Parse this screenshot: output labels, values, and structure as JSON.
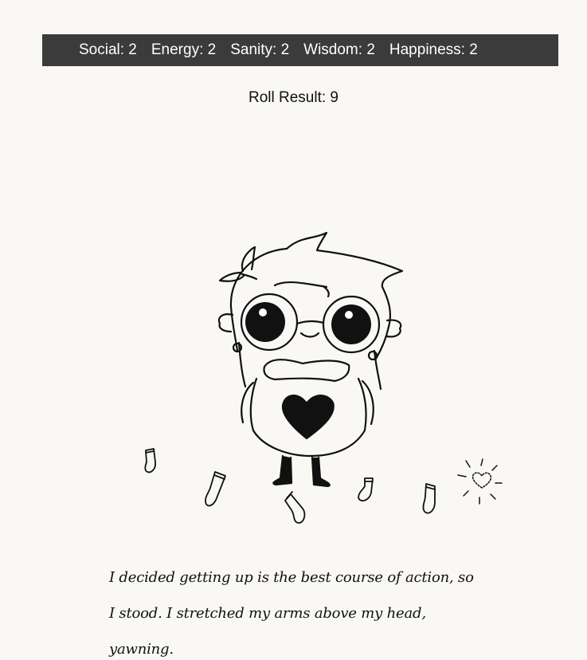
{
  "stats": [
    {
      "label": "Social",
      "value": 2,
      "text": "Social: 2"
    },
    {
      "label": "Energy",
      "value": 2,
      "text": "Energy: 2"
    },
    {
      "label": "Sanity",
      "value": 2,
      "text": "Sanity: 2"
    },
    {
      "label": "Wisdom",
      "value": 2,
      "text": "Wisdom: 2"
    },
    {
      "label": "Happiness",
      "value": 2,
      "text": "Happiness: 2"
    }
  ],
  "roll": {
    "text": "Roll Result: 9",
    "value": 9
  },
  "scene": {
    "character": "chibi-character-stretching",
    "props": [
      "sock-icon",
      "sock-icon",
      "sock-icon",
      "sock-icon",
      "sock-icon",
      "sparkle-heart-icon"
    ]
  },
  "narration": {
    "text": "I decided getting up is the best course of action, so I stood. I stretched my arms above my head, yawning."
  },
  "colors": {
    "bar_background": "#3b3b3b",
    "bar_text": "#ffffff",
    "page_background": "#f9f8f5",
    "ink": "#111111"
  }
}
